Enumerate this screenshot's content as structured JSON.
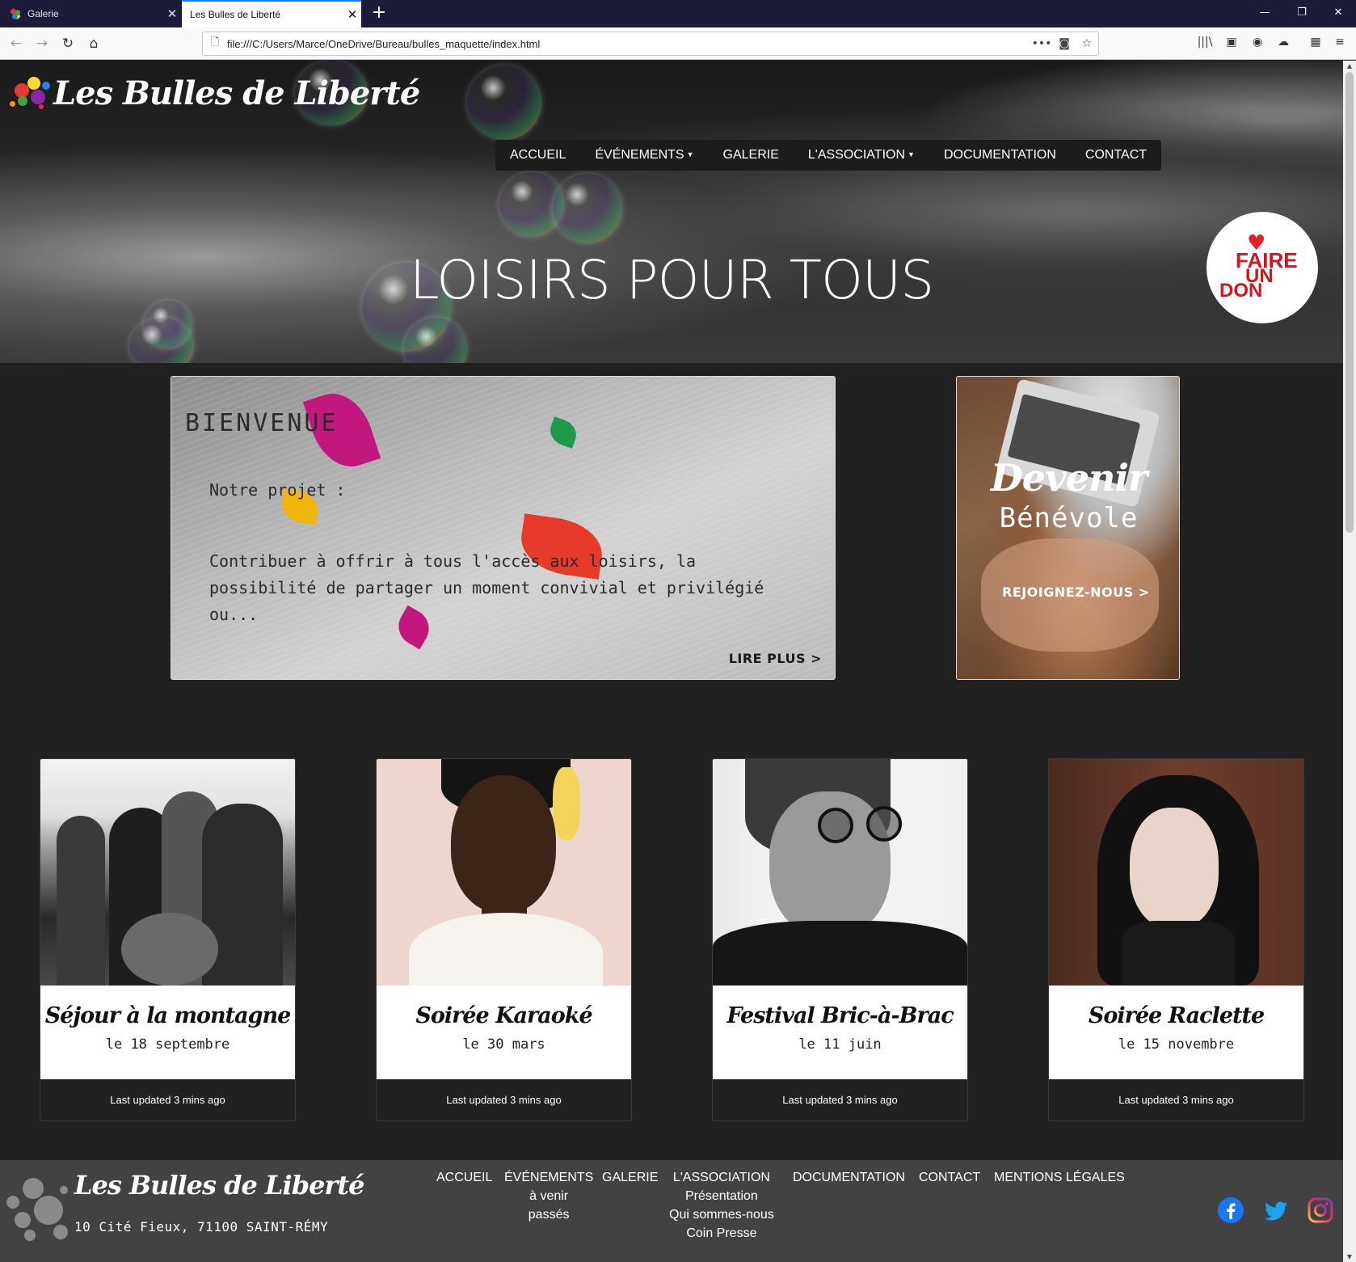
{
  "browser": {
    "tabs": [
      {
        "title": "Galerie",
        "active": false
      },
      {
        "title": "Les Bulles de Liberté",
        "active": true
      }
    ],
    "url": "file:///C:/Users/Marce/OneDrive/Bureau/bulles_maquette/index.html",
    "icons": [
      "back-icon",
      "forward-icon",
      "reload-icon",
      "home-icon",
      "page-icon",
      "more-icon",
      "pocket-icon",
      "bookmark-star-icon",
      "library-icon",
      "sidebar-icon",
      "account-icon",
      "extension-icon",
      "menu-icon"
    ]
  },
  "site": {
    "logo_text": "Les Bulles de Liberté",
    "nav": [
      {
        "label": "ACCUEIL",
        "dropdown": false
      },
      {
        "label": "ÉVÉNEMENTS",
        "dropdown": true
      },
      {
        "label": "GALERIE",
        "dropdown": false
      },
      {
        "label": "L'ASSOCIATION",
        "dropdown": true
      },
      {
        "label": "DOCUMENTATION",
        "dropdown": false
      },
      {
        "label": "CONTACT",
        "dropdown": false
      }
    ],
    "hero_title": "LOISIRS POUR TOUS",
    "donate": {
      "line1": "FAIRE",
      "line2": "UN",
      "line3": "DON",
      "color": "#d0171f"
    }
  },
  "welcome": {
    "heading": "BIENVENUE",
    "subheading": "Notre projet :",
    "body": "Contribuer à offrir à tous l'accès aux loisirs, la possibilité de partager un moment convivial et privilégié ou...",
    "more_label": "LIRE PLUS >"
  },
  "volunteer": {
    "line1": "Devenir",
    "line2": "Bénévole",
    "cta": "REJOIGNEZ-NOUS >"
  },
  "events": [
    {
      "title": "Séjour à la montagne",
      "date": "le 18 septembre",
      "updated": "Last updated 3 mins ago"
    },
    {
      "title": "Soirée Karaoké",
      "date": "le 30 mars",
      "updated": "Last updated 3 mins ago"
    },
    {
      "title": "Festival Bric-à-Brac",
      "date": "le 11 juin",
      "updated": "Last updated 3 mins ago"
    },
    {
      "title": "Soirée Raclette",
      "date": "le 15 novembre",
      "updated": "Last updated 3 mins ago"
    }
  ],
  "footer": {
    "logo_text": "Les Bulles de Liberté",
    "address": "10 Cité Fieux, 71100 SAINT-RÉMY",
    "links": {
      "accueil": "ACCUEIL",
      "evenements": "ÉVÉNEMENTS",
      "evenements_sub": [
        "à venir",
        "passés"
      ],
      "galerie": "GALERIE",
      "association": "L'ASSOCIATION",
      "association_sub": [
        "Présentation",
        "Qui sommes-nous",
        "Coin Presse"
      ],
      "documentation": "DOCUMENTATION",
      "contact": "CONTACT",
      "mentions": "MENTIONS LÉGALES"
    },
    "social": [
      {
        "icon": "facebook-icon",
        "color": "#1877f2"
      },
      {
        "icon": "twitter-icon",
        "color": "#1da1f2"
      },
      {
        "icon": "instagram-icon",
        "color": "#c13584"
      }
    ]
  }
}
